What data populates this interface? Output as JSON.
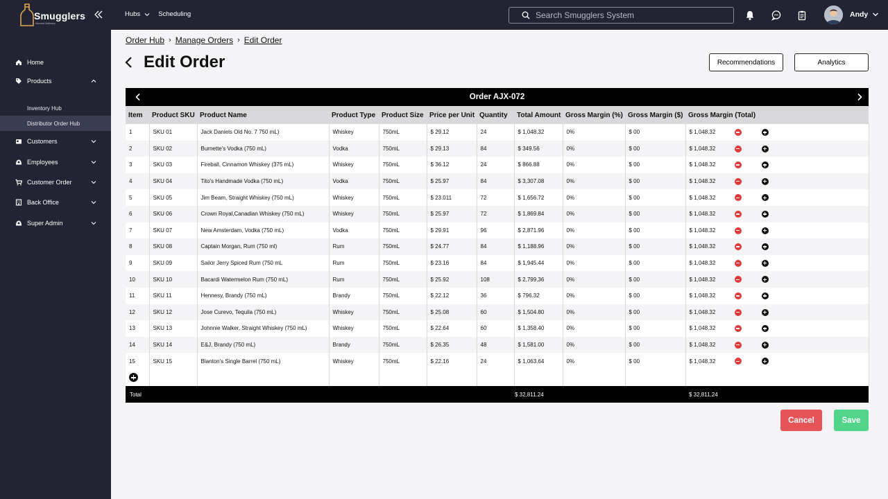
{
  "brand": {
    "name": "Smugglers",
    "tagline": "Alcohol Delivery"
  },
  "topnav": {
    "hubs": "Hubs",
    "scheduling": "Scheduling"
  },
  "search": {
    "placeholder": "Search Smugglers System"
  },
  "user": {
    "name": "Andy"
  },
  "sidebar": {
    "home": "Home",
    "products": "Products",
    "inventory_hub": "Inventory Hub",
    "distributor_order_hub": "Distributor Order Hub",
    "customers": "Customers",
    "employees": "Employees",
    "customer_order": "Customer Order",
    "back_office": "Back Office",
    "super_admin": "Super Admin"
  },
  "breadcrumb": [
    "Order Hub",
    "Manage Orders",
    "Edit Order"
  ],
  "page": {
    "title": "Edit Order",
    "recommendations": "Recommendations",
    "analytics": "Analytics"
  },
  "order": {
    "title": "Order AJX-072"
  },
  "columns": [
    "Item",
    "Product SKU",
    "Product Name",
    "Product Type",
    "Product Size",
    "Price per Unit",
    "Quantity",
    "Total Amount",
    "Gross Margin (%)",
    "Gross Margin ($)",
    "Gross Margin (Total)"
  ],
  "rows": [
    [
      "1",
      "SKU 01",
      "Jack Daniels Old No. 7 750 mL)",
      "Whiskey",
      "750mL",
      "$ 29.12",
      "24",
      "$ 1,048.32",
      "0%",
      "$ 00",
      "$ 1,048.32"
    ],
    [
      "2",
      "SKU 02",
      "Burnette's Vodka (750 mL)",
      "Vodka",
      "750mL",
      "$ 29.13",
      "84",
      "$ 349.56",
      "0%",
      "$ 00",
      "$ 1,048.32"
    ],
    [
      "3",
      "SKU 03",
      "Fireball, Cinnamon Whiskey (375 mL)",
      "Whiskey",
      "750mL",
      "$ 36.12",
      "24",
      "$ 866.88",
      "0%",
      "$ 00",
      "$ 1,048.32"
    ],
    [
      "4",
      "SKU 04",
      "Tito's Handmade Vodka (750 mL)",
      "Vodka",
      "750mL",
      "$ 25.97",
      "84",
      "$ 3,307.08",
      "0%",
      "$ 00",
      "$ 1,048.32"
    ],
    [
      "5",
      "SKU 05",
      "Jim Beam, Straight Whiskey (750 mL)",
      "Whiskey",
      "750mL",
      "$ 23.011",
      "72",
      "$ 1,656.72",
      "0%",
      "$ 00",
      "$ 1,048.32"
    ],
    [
      "6",
      "SKU 06",
      "Crown Royal,Canadian Whiskey (750 mL)",
      "Whiskey",
      "750mL",
      "$ 25.97",
      "72",
      "$ 1,869.84",
      "0%",
      "$ 00",
      "$ 1,048.32"
    ],
    [
      "7",
      "SKU 07",
      "New Amsterdam, Vodka (750 mL)",
      "Vodka",
      "750mL",
      "$ 29.91",
      "96",
      "$ 2,871.96",
      "0%",
      "$ 00",
      "$ 1,048.32"
    ],
    [
      "8",
      "SKU 08",
      "Captain Morgan, Rum (750 ml)",
      "Rum",
      "750mL",
      "$ 24.77",
      "84",
      "$ 1,188.96",
      "0%",
      "$ 00",
      "$ 1,048.32"
    ],
    [
      "9",
      "SKU 09",
      "Sailor Jerry Spiced Rum (750 mL",
      "Rum",
      "750mL",
      "$ 23.16",
      "84",
      "$ 1,945.44",
      "0%",
      "$ 00",
      "$ 1,048.32"
    ],
    [
      "10",
      "SKU 10",
      "Bacardi Watermelon Rum (750 mL)",
      "Rum",
      "750mL",
      "$ 25.92",
      "108",
      "$ 2,799.36",
      "0%",
      "$ 00",
      "$ 1,048.32"
    ],
    [
      "11",
      "SKU 11",
      "Hennesy, Brandy (750 mL)",
      "Brandy",
      "750mL",
      "$ 22.12",
      "36",
      "$ 796.32",
      "0%",
      "$ 00",
      "$ 1,048.32"
    ],
    [
      "12",
      "SKU 12",
      "Jose Curevo, Tequila (750 mL)",
      "Whiskey",
      "750mL",
      "$ 25.08",
      "60",
      "$ 1,504.80",
      "0%",
      "$ 00",
      "$ 1,048.32"
    ],
    [
      "13",
      "SKU 13",
      "Johnnie Walker, Straight Whiskey (750 mL)",
      "Whiskey",
      "750mL",
      "$ 22.64",
      "60",
      "$ 1,358.40",
      "0%",
      "$ 00",
      "$ 1,048.32"
    ],
    [
      "14",
      "SKU 14",
      "E&J, Brandy (750 mL)",
      "Brandy",
      "750mL",
      "$ 26.35",
      "48",
      "$ 1,581.00",
      "0%",
      "$ 00",
      "$ 1,048.32"
    ],
    [
      "15",
      "SKU 15",
      "Blanton's Single Barrel (750 mL)",
      "Whiskey",
      "750mL",
      "$ 22.16",
      "24",
      "$ 1,063.64",
      "0%",
      "$ 00",
      "$ 1,048.32"
    ]
  ],
  "totals": {
    "label": "Total",
    "total_amount": "$ 32,811.24",
    "gross_margin_total": "$ 32,811.24"
  },
  "actions": {
    "cancel": "Cancel",
    "save": "Save"
  },
  "colors": {
    "dark": "#232433",
    "cancel": "#e65458",
    "save": "#52d48b",
    "remove": "#e03b3b"
  }
}
